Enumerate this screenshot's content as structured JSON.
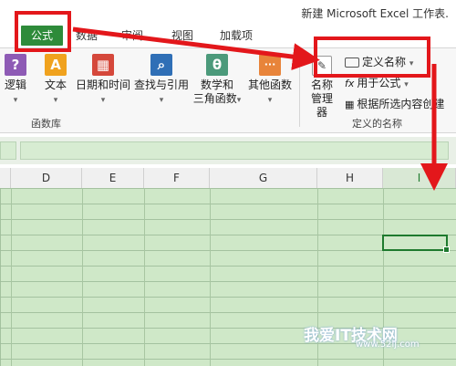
{
  "window": {
    "title": "新建 Microsoft Excel 工作表."
  },
  "tabs": [
    {
      "label": "公式",
      "active": true
    },
    {
      "label": "数据"
    },
    {
      "label": "审阅"
    },
    {
      "label": "视图"
    },
    {
      "label": "加载项"
    }
  ],
  "function_library": {
    "group_label": "函数库",
    "buttons": [
      {
        "label": "逻辑",
        "icon": "?",
        "color": "#8e5bb5"
      },
      {
        "label": "文本",
        "icon": "A",
        "color": "#f0a21e"
      },
      {
        "label": "日期和时间",
        "icon": "▦",
        "color": "#d5483b"
      },
      {
        "label": "查找与引用",
        "icon": "⌕",
        "color": "#2f6fb6"
      },
      {
        "label_line1": "数学和",
        "label_line2": "三角函数",
        "icon": "θ",
        "color": "#4c9a7b"
      },
      {
        "label": "其他函数",
        "icon": "···",
        "color": "#e8843a"
      }
    ]
  },
  "defined_names": {
    "group_label": "定义的名称",
    "name_manager_line1": "名称",
    "name_manager_line2": "管理器",
    "define_name": "定义名称",
    "use_in_formula": "用于公式",
    "create_from_selection": "根据所选内容创建"
  },
  "columns": [
    "D",
    "E",
    "F",
    "G",
    "H",
    "I"
  ],
  "watermark": {
    "text": "我爱IT技术网",
    "url": "www.52ij.com"
  },
  "colors": {
    "accent": "#2e8b3a",
    "annotation": "#e3171b",
    "sheet": "#cfe8c8"
  }
}
